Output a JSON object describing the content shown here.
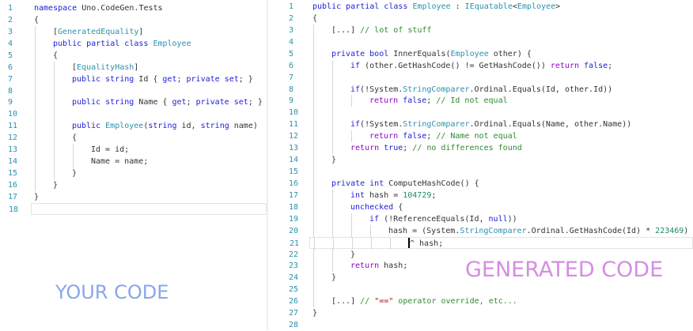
{
  "left": {
    "current_line": 18,
    "lines": [
      {
        "n": "1",
        "i": 0,
        "tk": [
          [
            "k",
            "namespace"
          ],
          [
            "p",
            " Uno.CodeGen.Tests"
          ]
        ]
      },
      {
        "n": "2",
        "i": 0,
        "tk": [
          [
            "p",
            "{"
          ]
        ]
      },
      {
        "n": "3",
        "i": 1,
        "tk": [
          [
            "p",
            "["
          ],
          [
            "a",
            "GeneratedEquality"
          ],
          [
            "p",
            "]"
          ]
        ]
      },
      {
        "n": "4",
        "i": 1,
        "tk": [
          [
            "k",
            "public partial class "
          ],
          [
            "t",
            "Employee"
          ]
        ]
      },
      {
        "n": "5",
        "i": 1,
        "tk": [
          [
            "p",
            "{"
          ]
        ]
      },
      {
        "n": "6",
        "i": 2,
        "tk": [
          [
            "p",
            "["
          ],
          [
            "a",
            "EqualityHash"
          ],
          [
            "p",
            "]"
          ]
        ]
      },
      {
        "n": "7",
        "i": 2,
        "tk": [
          [
            "k",
            "public string "
          ],
          [
            "p",
            "Id { "
          ],
          [
            "k",
            "get"
          ],
          [
            "p",
            "; "
          ],
          [
            "k",
            "private set"
          ],
          [
            "p",
            "; }"
          ]
        ]
      },
      {
        "n": "8",
        "i": 2,
        "tk": []
      },
      {
        "n": "9",
        "i": 2,
        "tk": [
          [
            "k",
            "public string "
          ],
          [
            "p",
            "Name { "
          ],
          [
            "k",
            "get"
          ],
          [
            "p",
            "; "
          ],
          [
            "k",
            "private set"
          ],
          [
            "p",
            "; }"
          ]
        ]
      },
      {
        "n": "10",
        "i": 2,
        "tk": []
      },
      {
        "n": "11",
        "i": 2,
        "tk": [
          [
            "k",
            "public "
          ],
          [
            "t",
            "Employee"
          ],
          [
            "p",
            "("
          ],
          [
            "k",
            "string "
          ],
          [
            "p",
            "id, "
          ],
          [
            "k",
            "string "
          ],
          [
            "p",
            "name)"
          ]
        ]
      },
      {
        "n": "12",
        "i": 2,
        "tk": [
          [
            "p",
            "{"
          ]
        ]
      },
      {
        "n": "13",
        "i": 3,
        "tk": [
          [
            "p",
            "Id = id;"
          ]
        ]
      },
      {
        "n": "14",
        "i": 3,
        "tk": [
          [
            "p",
            "Name = name;"
          ]
        ]
      },
      {
        "n": "15",
        "i": 2,
        "tk": [
          [
            "p",
            "}"
          ]
        ]
      },
      {
        "n": "16",
        "i": 1,
        "tk": [
          [
            "p",
            "}"
          ]
        ]
      },
      {
        "n": "17",
        "i": 0,
        "tk": [
          [
            "p",
            "}"
          ]
        ]
      },
      {
        "n": "18",
        "i": 0,
        "tk": []
      }
    ]
  },
  "right": {
    "current_line": 21,
    "lines": [
      {
        "n": "1",
        "i": 0,
        "tk": [
          [
            "k",
            "public partial class "
          ],
          [
            "t",
            "Employee"
          ],
          [
            "p",
            " : "
          ],
          [
            "t",
            "IEquatable"
          ],
          [
            "p",
            "<"
          ],
          [
            "t",
            "Employee"
          ],
          [
            "p",
            ">"
          ]
        ]
      },
      {
        "n": "2",
        "i": 0,
        "tk": [
          [
            "p",
            "{"
          ]
        ]
      },
      {
        "n": "3",
        "i": 1,
        "tk": [
          [
            "p",
            "[...] "
          ],
          [
            "c",
            "// lot of stuff"
          ]
        ]
      },
      {
        "n": "4",
        "i": 1,
        "tk": []
      },
      {
        "n": "5",
        "i": 1,
        "tk": [
          [
            "k",
            "private bool "
          ],
          [
            "p",
            "InnerEquals("
          ],
          [
            "t",
            "Employee"
          ],
          [
            "p",
            " other) {"
          ]
        ]
      },
      {
        "n": "6",
        "i": 2,
        "tk": [
          [
            "k",
            "if"
          ],
          [
            "p",
            " (other.GetHashCode() != GetHashCode()) "
          ],
          [
            "kp",
            "return "
          ],
          [
            "k",
            "false"
          ],
          [
            "p",
            ";"
          ]
        ]
      },
      {
        "n": "7",
        "i": 2,
        "tk": []
      },
      {
        "n": "8",
        "i": 2,
        "tk": [
          [
            "k",
            "if"
          ],
          [
            "p",
            "(!System."
          ],
          [
            "t",
            "StringComparer"
          ],
          [
            "p",
            ".Ordinal.Equals(Id, other.Id))"
          ]
        ]
      },
      {
        "n": "9",
        "i": 3,
        "tk": [
          [
            "kp",
            "return "
          ],
          [
            "k",
            "false"
          ],
          [
            "p",
            "; "
          ],
          [
            "c",
            "// Id not equal"
          ]
        ]
      },
      {
        "n": "10",
        "i": 2,
        "tk": []
      },
      {
        "n": "11",
        "i": 2,
        "tk": [
          [
            "k",
            "if"
          ],
          [
            "p",
            "(!System."
          ],
          [
            "t",
            "StringComparer"
          ],
          [
            "p",
            ".Ordinal.Equals(Name, other.Name))"
          ]
        ]
      },
      {
        "n": "12",
        "i": 3,
        "tk": [
          [
            "kp",
            "return "
          ],
          [
            "k",
            "false"
          ],
          [
            "p",
            "; "
          ],
          [
            "c",
            "// Name not equal"
          ]
        ]
      },
      {
        "n": "13",
        "i": 2,
        "tk": [
          [
            "kp",
            "return "
          ],
          [
            "k",
            "true"
          ],
          [
            "p",
            "; "
          ],
          [
            "c",
            "// no differences found"
          ]
        ]
      },
      {
        "n": "14",
        "i": 1,
        "tk": [
          [
            "p",
            "}"
          ]
        ]
      },
      {
        "n": "15",
        "i": 1,
        "tk": []
      },
      {
        "n": "16",
        "i": 1,
        "tk": [
          [
            "k",
            "private int "
          ],
          [
            "p",
            "ComputeHashCode() {"
          ]
        ]
      },
      {
        "n": "17",
        "i": 2,
        "tk": [
          [
            "k",
            "int "
          ],
          [
            "p",
            "hash = "
          ],
          [
            "n",
            "104729"
          ],
          [
            "p",
            ";"
          ]
        ]
      },
      {
        "n": "18",
        "i": 2,
        "tk": [
          [
            "k",
            "unchecked"
          ],
          [
            "p",
            " {"
          ]
        ]
      },
      {
        "n": "19",
        "i": 3,
        "tk": [
          [
            "k",
            "if"
          ],
          [
            "p",
            " (!ReferenceEquals(Id, "
          ],
          [
            "k",
            "null"
          ],
          [
            "p",
            "))"
          ]
        ]
      },
      {
        "n": "20",
        "i": 4,
        "tk": [
          [
            "p",
            "hash = (System."
          ],
          [
            "t",
            "StringComparer"
          ],
          [
            "p",
            ".Ordinal.GetHashCode(Id) * "
          ],
          [
            "n",
            "223469"
          ],
          [
            "p",
            ")"
          ]
        ]
      },
      {
        "n": "21",
        "i": 5,
        "tk": [
          [
            "caret",
            ""
          ],
          [
            "p",
            "^ hash;"
          ]
        ]
      },
      {
        "n": "22",
        "i": 2,
        "tk": [
          [
            "p",
            "}"
          ]
        ]
      },
      {
        "n": "23",
        "i": 2,
        "tk": [
          [
            "kp",
            "return "
          ],
          [
            "p",
            "hash;"
          ]
        ]
      },
      {
        "n": "24",
        "i": 1,
        "tk": [
          [
            "p",
            "}"
          ]
        ]
      },
      {
        "n": "25",
        "i": 1,
        "tk": []
      },
      {
        "n": "26",
        "i": 1,
        "tk": [
          [
            "p",
            "[...] "
          ],
          [
            "c",
            "// "
          ],
          [
            "s",
            "\"==\""
          ],
          [
            "c",
            " operator override, etc..."
          ]
        ]
      },
      {
        "n": "27",
        "i": 0,
        "tk": [
          [
            "p",
            "}"
          ]
        ]
      },
      {
        "n": "28",
        "i": 0,
        "tk": []
      }
    ]
  },
  "labels": {
    "your_code": "YOUR CODE",
    "generated_code": "GENERATED CODE"
  }
}
